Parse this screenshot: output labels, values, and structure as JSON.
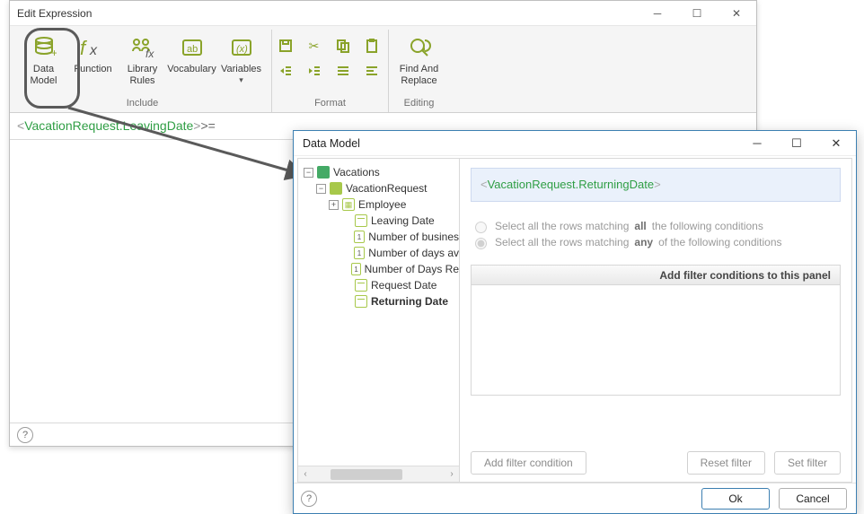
{
  "edit_window": {
    "title": "Edit Expression",
    "expression_html": "<VacationRequest.LeavingDate>>=",
    "expression_tag1": "<",
    "expression_inner": "VacationRequest.LeavingDate",
    "expression_tag2": ">",
    "expression_op": ">="
  },
  "ribbon": {
    "include": {
      "data_model": "Data\nModel",
      "function": "Function",
      "library_rules": "Library\nRules",
      "vocabulary": "Vocabulary",
      "variables": "Variables",
      "label": "Include"
    },
    "format": {
      "label": "Format"
    },
    "editing": {
      "find_replace": "Find And\nReplace",
      "label": "Editing"
    }
  },
  "dm_window": {
    "title": "Data Model",
    "tree": {
      "root": "Vacations",
      "entity": "VacationRequest",
      "children": [
        {
          "label": "Employee",
          "icon": "employee",
          "expandable": true
        },
        {
          "label": "Leaving Date",
          "icon": "cal"
        },
        {
          "label": "Number of busines",
          "icon": "num"
        },
        {
          "label": "Number of days av",
          "icon": "num"
        },
        {
          "label": "Number of Days Re",
          "icon": "num"
        },
        {
          "label": "Request Date",
          "icon": "cal"
        },
        {
          "label": "Returning Date",
          "icon": "cal",
          "bold": true
        }
      ]
    },
    "selected_expr_open": "<",
    "selected_expr_body": "VacationRequest.ReturningDate",
    "selected_expr_close": ">",
    "radio_all_prefix": "Select all the rows matching ",
    "radio_all_bold": "all",
    "radio_all_suffix": " the following conditions",
    "radio_any_prefix": "Select all the rows matching ",
    "radio_any_bold": "any",
    "radio_any_suffix": " of the following conditions",
    "filter_header": "Add filter conditions to this panel",
    "btn_add_filter": "Add filter condition",
    "btn_reset_filter": "Reset  filter",
    "btn_set_filter": "Set  filter",
    "btn_ok": "Ok",
    "btn_cancel": "Cancel"
  }
}
